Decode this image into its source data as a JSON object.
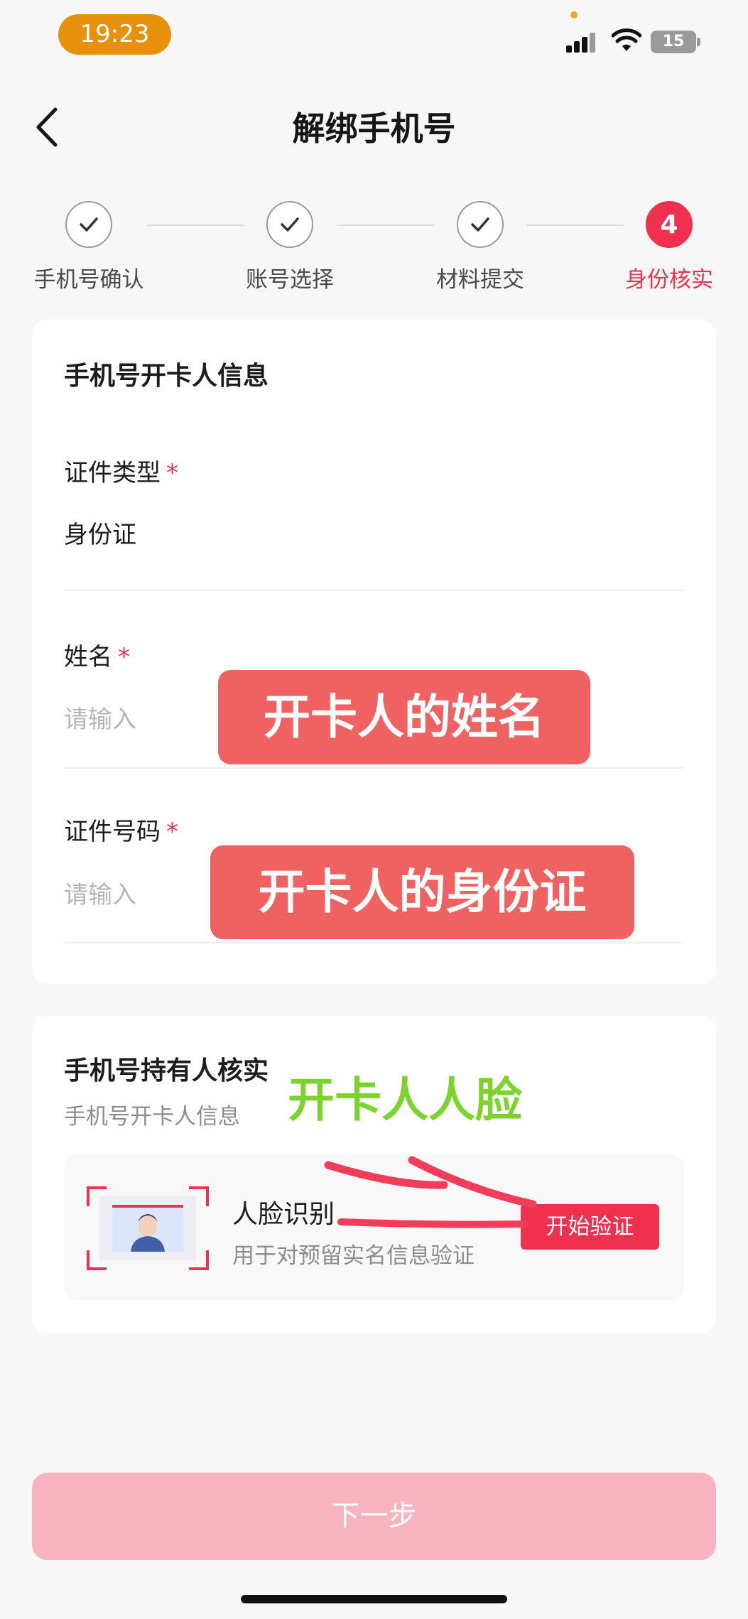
{
  "status_bar": {
    "time": "19:23",
    "battery": "15"
  },
  "header": {
    "title": "解绑手机号"
  },
  "steps": [
    {
      "label": "手机号确认",
      "state": "done"
    },
    {
      "label": "账号选择",
      "state": "done"
    },
    {
      "label": "材料提交",
      "state": "done"
    },
    {
      "label": "身份核实",
      "state": "active",
      "number": "4"
    }
  ],
  "owner_card": {
    "title": "手机号开卡人信息",
    "fields": [
      {
        "label": "证件类型",
        "required": "*",
        "value": "身份证"
      },
      {
        "label": "姓名",
        "required": "*",
        "placeholder": "请输入",
        "annotation": "开卡人的姓名"
      },
      {
        "label": "证件号码",
        "required": "*",
        "placeholder": "请输入",
        "annotation": "开卡人的身份证"
      }
    ]
  },
  "verify_card": {
    "title": "手机号持有人核实",
    "subtitle": "手机号开卡人信息",
    "annotation": "开卡人人脸",
    "face": {
      "label": "人脸识别",
      "desc": "用于对预留实名信息验证",
      "button": "开始验证"
    }
  },
  "next_button": "下一步",
  "colors": {
    "accent": "#f0304f",
    "annotation_red": "#f06262",
    "annotation_green": "#7bd32c",
    "time_pill": "#e6900c"
  },
  "icons": [
    "back-arrow-icon",
    "check-icon",
    "signal-icon",
    "wifi-icon",
    "battery-icon",
    "face-id-icon"
  ]
}
